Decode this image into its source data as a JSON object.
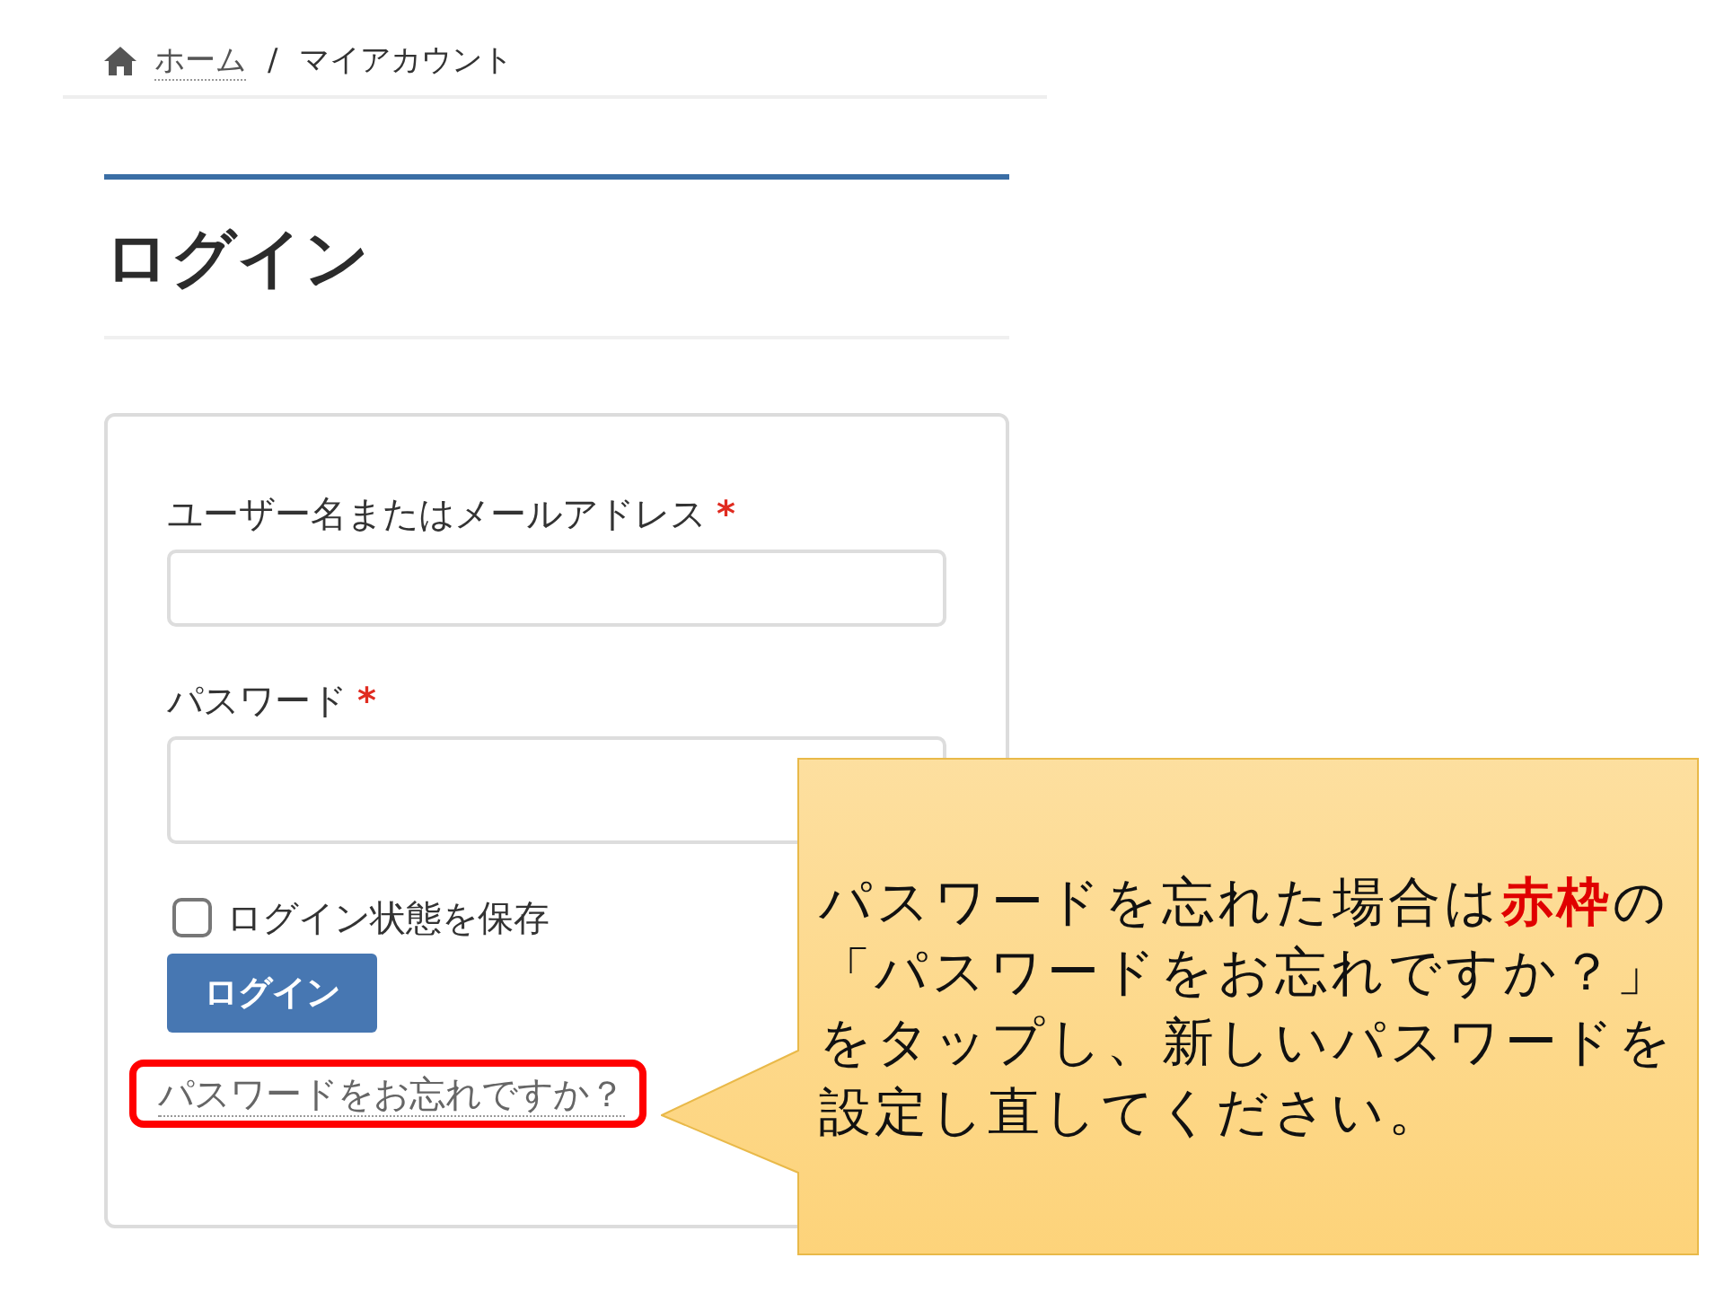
{
  "breadcrumb": {
    "items": [
      {
        "label": "ホーム",
        "kind": "link"
      },
      {
        "label": "マイアカウント",
        "kind": "current"
      }
    ],
    "separator": "/"
  },
  "page_title": "ログイン",
  "login_form": {
    "fields": [
      {
        "label": "ユーザー名またはメールアドレス",
        "required_mark": "*",
        "kind": "text"
      },
      {
        "label": "パスワード",
        "required_mark": "*",
        "kind": "password"
      }
    ],
    "remember": {
      "label": "ログイン状態を保存",
      "checked": false
    },
    "submit_button": "ログイン",
    "lost_password_link": {
      "label": "パスワードをお忘れですか？",
      "highlighted": true
    }
  },
  "callout": {
    "text": "パスワードを忘れた場合は**赤枠**の「パスワードをお忘れですか？」をタップし、新しいパスワードを設定し直してください。"
  }
}
